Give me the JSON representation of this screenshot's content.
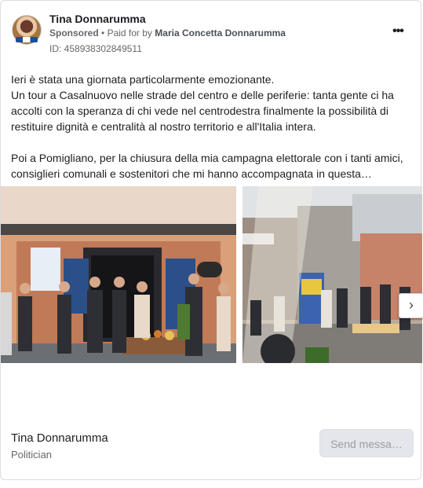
{
  "advertiser": {
    "name": "Tina Donnarumma",
    "sponsored_label": "Sponsored",
    "separator": "•",
    "paid_for_prefix": "Paid for by",
    "paid_for_name": "Maria Concetta Donnarumma",
    "ad_id": "ID: 458938302849511"
  },
  "post": {
    "line1": "Ieri è stata una giornata particolarmente emozionante.",
    "paragraph1": "Un tour a Casalnuovo nelle strade del centro e delle periferie: tanta gente ci ha accolti con la speranza di chi vede nel centrodestra finalmente la possibilità di restituire dignità e centralità al nostro territorio e all'Italia intera.",
    "paragraph2": "Poi a Pomigliano, per la chiusura della mia campagna elettorale con i tanti amici, consiglieri comunali e sostenitori che mi hanno accompagnata in questa…"
  },
  "carousel": {
    "next_icon": "chevron-right-icon",
    "next_glyph": "›"
  },
  "footer": {
    "page_name": "Tina Donnarumma",
    "category": "Politician",
    "send_button": "Send messa…"
  },
  "colors": {
    "text_primary": "#1c1e21",
    "text_secondary": "#65676b",
    "button_disabled_bg": "#e4e6eb",
    "button_disabled_text": "#9a9da2"
  }
}
